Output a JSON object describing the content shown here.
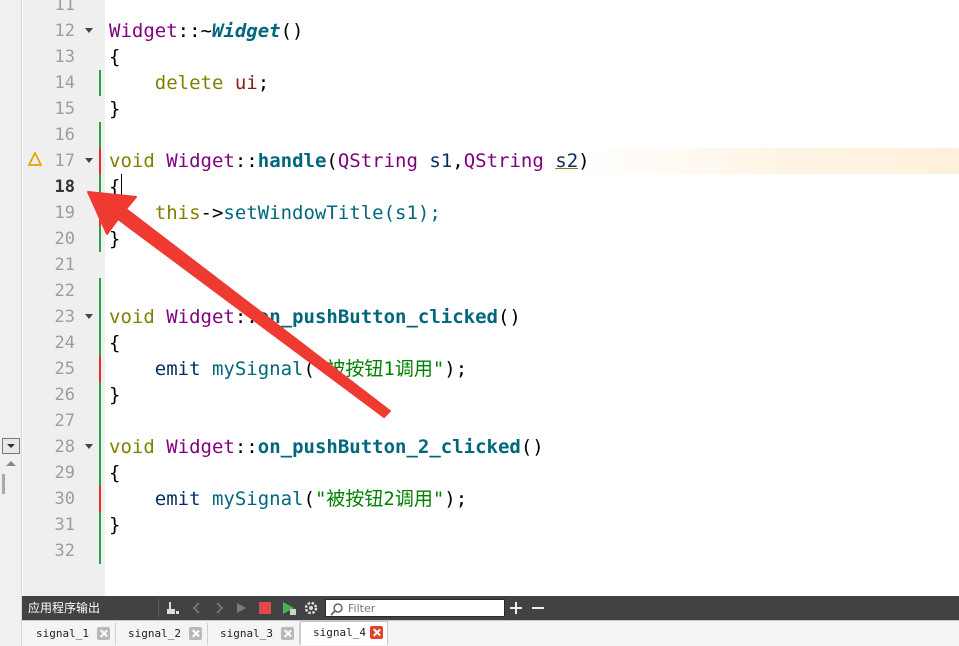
{
  "editor": {
    "line_numbers": [
      "11",
      "12",
      "13",
      "14",
      "15",
      "16",
      "17",
      "18",
      "19",
      "20",
      "21",
      "22",
      "23",
      "24",
      "25",
      "26",
      "27",
      "28",
      "29",
      "30",
      "31",
      "32"
    ],
    "current_line": "18",
    "lines": {
      "l12": {
        "cls": "Widget",
        "sep": "::~",
        "fn": "Widget",
        "rest": "()"
      },
      "l13": "{",
      "l14": {
        "kw": "delete",
        "var": "ui",
        "rest": ";"
      },
      "l15": "}",
      "l17": {
        "ty": "void",
        "cls": "Widget",
        "sep": "::",
        "fn": "handle",
        "p1": "(",
        "qs1": "QString",
        "a1": "s1",
        "comma": ",",
        "qs2": "QString",
        "a2": "s2",
        "p2": ")"
      },
      "l18": "{",
      "l19": {
        "kw": "this",
        "arrow": "->",
        "call": "setWindowTitle(s1);"
      },
      "l20": "}",
      "l23": {
        "ty": "void",
        "cls": "Widget",
        "sep": "::",
        "fn": "on_pushButton_clicked",
        "rest": "()"
      },
      "l24": "{",
      "l25": {
        "kw": "emit",
        "sig": "mySignal",
        "p1": "(",
        "str": "\"被按钮1调用\"",
        "p2": ");"
      },
      "l26": "}",
      "l28": {
        "ty": "void",
        "cls": "Widget",
        "sep": "::",
        "fn": "on_pushButton_2_clicked",
        "rest": "()"
      },
      "l29": "{",
      "l30": {
        "kw": "emit",
        "sig": "mySignal",
        "p1": "(",
        "str": "\"被按钮2调用\"",
        "p2": ");"
      },
      "l31": "}"
    }
  },
  "output_pane": {
    "title": "应用程序输出",
    "filter_placeholder": "Filter",
    "tabs": [
      {
        "label": "signal_1"
      },
      {
        "label": "signal_2"
      },
      {
        "label": "signal_3"
      },
      {
        "label": "signal_4",
        "active": true
      }
    ]
  },
  "colors": {
    "keyword": "#808000",
    "class": "#800080",
    "function": "#00677c",
    "string": "#008000",
    "arrow_annotation": "#ee3a30",
    "toolbar_bg": "#404244"
  },
  "icons": [
    "warning-icon",
    "fold-icon",
    "broom-icon",
    "prev-icon",
    "next-icon",
    "run-icon",
    "stop-icon",
    "debug-run-icon",
    "settings-icon",
    "search-icon",
    "zoom-in-icon",
    "zoom-out-icon",
    "close-icon"
  ]
}
